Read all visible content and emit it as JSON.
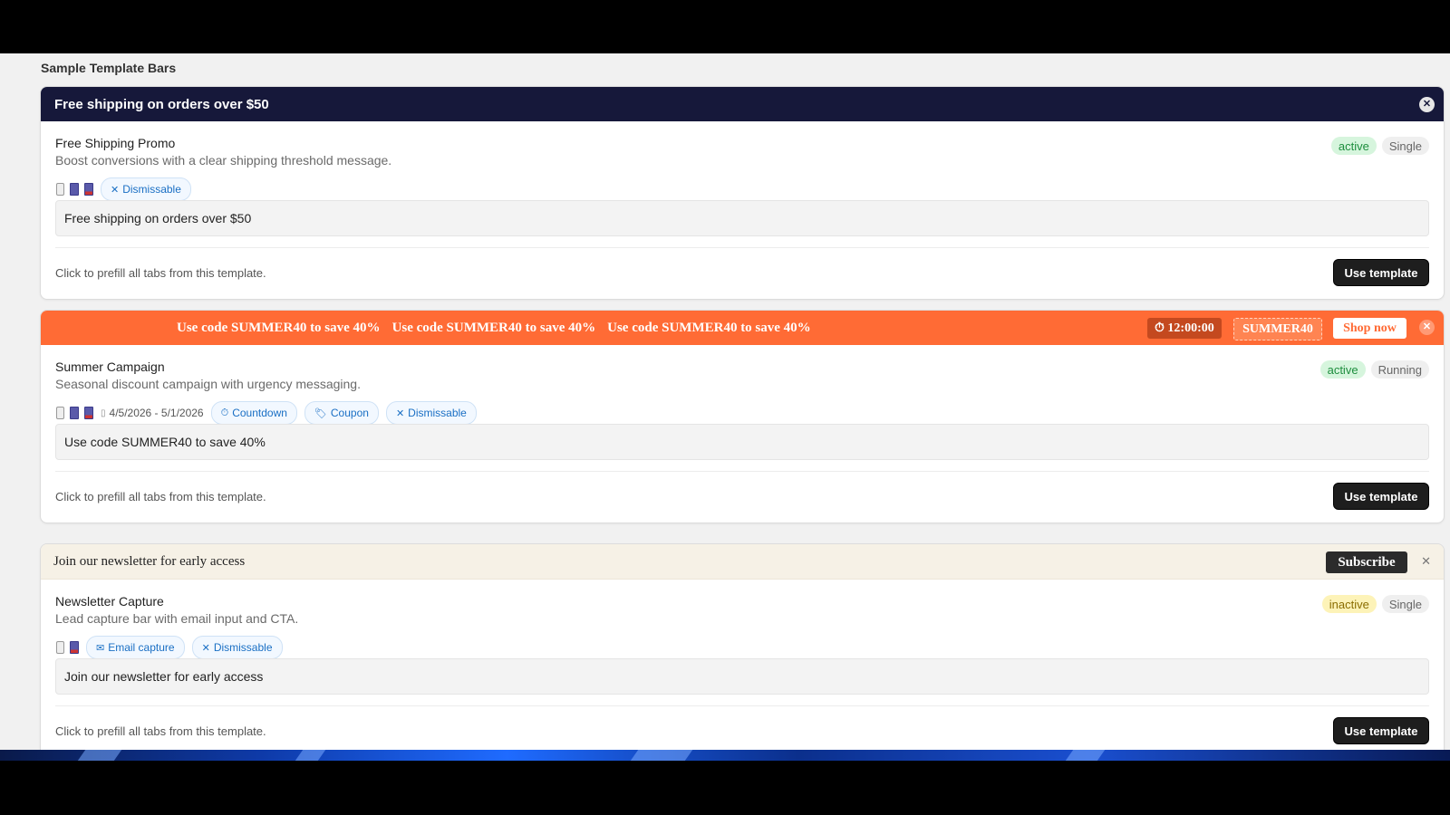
{
  "section_title": "Sample Template Bars",
  "cards": [
    {
      "bar": {
        "text": "Free shipping on orders over $50",
        "close": "✕"
      },
      "name": "Free Shipping Promo",
      "description": "Boost conversions with a clear shipping threshold message.",
      "status": "active",
      "mode": "Single",
      "chips": [
        {
          "icon": "✕",
          "label": "Dismissable"
        }
      ],
      "preview": "Free shipping on orders over $50",
      "hint": "Click to prefill all tabs from this template.",
      "button": "Use template"
    },
    {
      "bar": {
        "messages": [
          "Use code SUMMER40 to save 40%",
          "Use code SUMMER40 to save 40%",
          "Use code SUMMER40 to save 40%"
        ],
        "timer": "⏱ 12:00:00",
        "coupon": "SUMMER40",
        "shop": "Shop now",
        "close": "✕"
      },
      "name": "Summer Campaign",
      "description": "Seasonal discount campaign with urgency messaging.",
      "status": "active",
      "mode": "Running",
      "date_range": "4/5/2026 - 5/1/2026",
      "chips": [
        {
          "icon": "⏱",
          "label": "Countdown"
        },
        {
          "icon": "🏷",
          "label": "Coupon"
        },
        {
          "icon": "✕",
          "label": "Dismissable"
        }
      ],
      "preview": "Use code SUMMER40 to save 40%",
      "hint": "Click to prefill all tabs from this template.",
      "button": "Use template"
    },
    {
      "bar": {
        "text": "Join our newsletter for early access",
        "subscribe": "Subscribe",
        "close": "✕"
      },
      "name": "Newsletter Capture",
      "description": "Lead capture bar with email input and CTA.",
      "status": "inactive",
      "mode": "Single",
      "chips": [
        {
          "icon": "✉",
          "label": "Email capture"
        },
        {
          "icon": "✕",
          "label": "Dismissable"
        }
      ],
      "preview": "Join our newsletter for early access",
      "hint": "Click to prefill all tabs from this template.",
      "button": "Use template"
    }
  ],
  "colors": {
    "dark_bar": "#16183a",
    "orange_bar": "#ff6b35",
    "cream_bar": "#f6f1e6",
    "active_badge": "#d6f5dd",
    "inactive_badge": "#fdf3b8",
    "chip_text": "#1a6fc4"
  }
}
